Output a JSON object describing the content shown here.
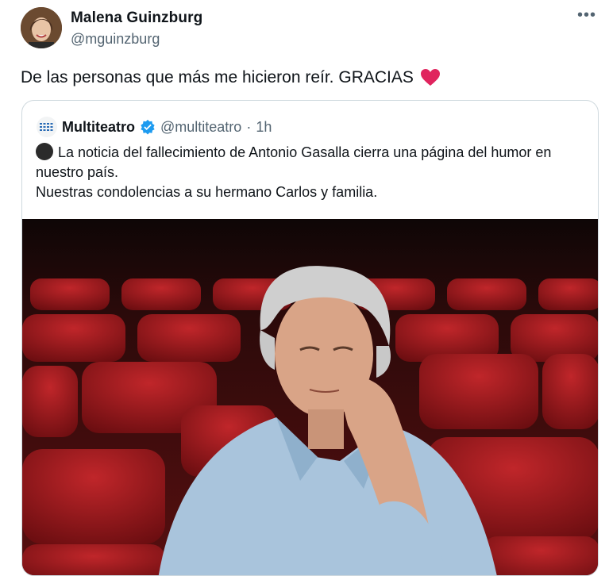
{
  "author": {
    "name": "Malena Guinzburg",
    "handle": "@mguinzburg"
  },
  "tweet": {
    "text": "De las personas que más me hicieron reír. GRACIAS",
    "emoji": "red-heart"
  },
  "menu_icon": "more-horizontal",
  "quoted": {
    "name": "Multiteatro",
    "handle": "@multiteatro",
    "separator": "·",
    "time": "1h",
    "line1": "La noticia del fallecimiento de Antonio Gasalla cierra una página del humor en nuestro país.",
    "line2": "Nuestras condolencias a su hermano Carlos y familia.",
    "bullet_emoji": "black-circle",
    "photo_description": "man-in-theater-seats"
  },
  "colors": {
    "text": "#0f1419",
    "muted": "#536471",
    "border": "#cfd9de",
    "verified": "#1d9bf0",
    "heart": "#e0245e"
  }
}
